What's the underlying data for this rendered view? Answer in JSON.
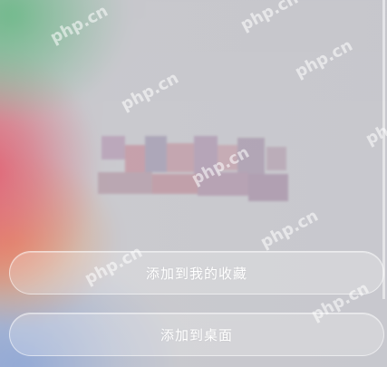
{
  "actions": {
    "add_to_favorites": "添加到我的收藏",
    "add_to_desktop": "添加到桌面"
  },
  "watermark": {
    "text": "php.cn"
  },
  "colors": {
    "button_text": "#ffffff",
    "background": "#c9c9ce"
  }
}
